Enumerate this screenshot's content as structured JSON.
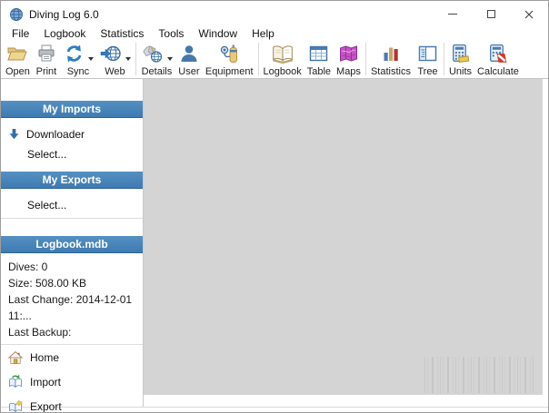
{
  "window": {
    "title": "Diving Log 6.0"
  },
  "menu": {
    "items": [
      "File",
      "Logbook",
      "Statistics",
      "Tools",
      "Window",
      "Help"
    ]
  },
  "toolbar": {
    "items": [
      {
        "label": "Open",
        "icon": "open-folder-icon",
        "dropdown": false
      },
      {
        "label": "Print",
        "icon": "printer-icon",
        "dropdown": false
      },
      {
        "label": "Sync",
        "icon": "sync-icon",
        "dropdown": true
      },
      {
        "label": "Web",
        "icon": "web-icon",
        "dropdown": true
      },
      {
        "label": "Details",
        "icon": "dive-details-icon",
        "dropdown": true
      },
      {
        "label": "User",
        "icon": "user-icon",
        "dropdown": false
      },
      {
        "label": "Equipment",
        "icon": "equipment-icon",
        "dropdown": false
      },
      {
        "label": "Logbook",
        "icon": "logbook-icon",
        "dropdown": false
      },
      {
        "label": "Table",
        "icon": "table-icon",
        "dropdown": false
      },
      {
        "label": "Maps",
        "icon": "maps-icon",
        "dropdown": false
      },
      {
        "label": "Statistics",
        "icon": "statistics-icon",
        "dropdown": false
      },
      {
        "label": "Tree",
        "icon": "tree-icon",
        "dropdown": false
      },
      {
        "label": "Units",
        "icon": "units-icon",
        "dropdown": false
      },
      {
        "label": "Calculate",
        "icon": "calculate-icon",
        "dropdown": false
      }
    ]
  },
  "sidebar": {
    "sections": [
      {
        "header": "My Imports",
        "items": [
          {
            "label": "Downloader",
            "icon": "download-arrow-icon"
          },
          {
            "label": "Select..."
          }
        ]
      },
      {
        "header": "My Exports",
        "items": [
          {
            "label": "Select..."
          }
        ]
      },
      {
        "header": "Logbook.mdb",
        "info": [
          "Dives: 0",
          "Size: 508.00 KB",
          "Last Change: 2014-12-01 11:...",
          "Last Backup:"
        ]
      }
    ],
    "nav": [
      {
        "label": "Home",
        "icon": "home-icon"
      },
      {
        "label": "Import",
        "icon": "import-book-icon"
      },
      {
        "label": "Export",
        "icon": "export-book-icon"
      }
    ]
  },
  "colors": {
    "section_header_blue": "#4381B8",
    "content_gray": "#D4D4D4",
    "accent_blue": "#2E79B5"
  }
}
